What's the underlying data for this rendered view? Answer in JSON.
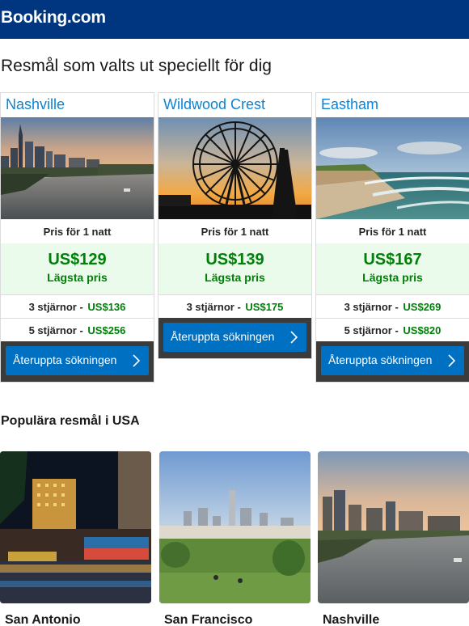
{
  "header": {
    "logo": "Booking.com"
  },
  "recommended": {
    "title": "Resmål som valts ut speciellt för dig",
    "cards": [
      {
        "city": "Nashville",
        "price_for": "Pris för 1 natt",
        "price": "US$129",
        "lowest": "Lägsta pris",
        "tiers": [
          {
            "label": "3 stjärnor -",
            "price": "US$136"
          },
          {
            "label": "5 stjärnor -",
            "price": "US$256"
          }
        ],
        "cta": "Återuppta sökningen"
      },
      {
        "city": "Wildwood Crest",
        "price_for": "Pris för 1 natt",
        "price": "US$139",
        "lowest": "Lägsta pris",
        "tiers": [
          {
            "label": "3 stjärnor -",
            "price": "US$175"
          }
        ],
        "cta": "Återuppta sökningen"
      },
      {
        "city": "Eastham",
        "price_for": "Pris för 1 natt",
        "price": "US$167",
        "lowest": "Lägsta pris",
        "tiers": [
          {
            "label": "3 stjärnor -",
            "price": "US$269"
          },
          {
            "label": "5 stjärnor -",
            "price": "US$820"
          }
        ],
        "cta": "Återuppta sökningen"
      }
    ]
  },
  "popular": {
    "title": "Populära resmål i USA",
    "destinations": [
      {
        "city": "San Antonio"
      },
      {
        "city": "San Francisco"
      },
      {
        "city": "Nashville"
      }
    ]
  },
  "colors": {
    "brand": "#003580",
    "link": "#0c84d6",
    "price_green": "#008009",
    "cta": "#0071c2"
  }
}
